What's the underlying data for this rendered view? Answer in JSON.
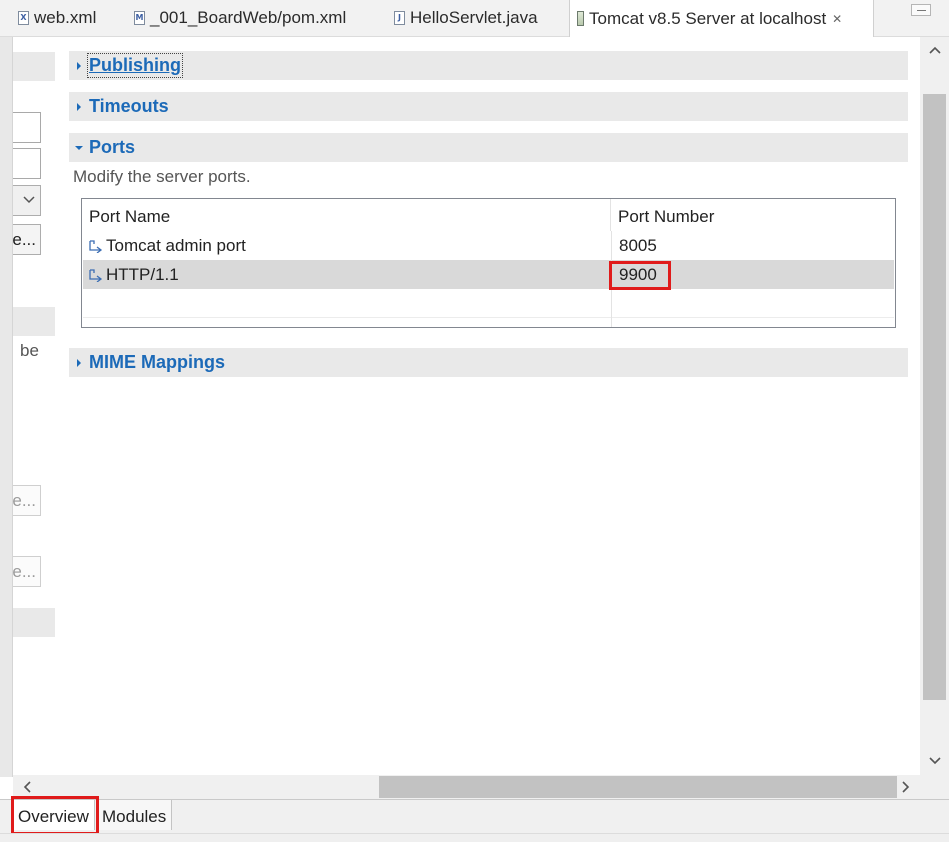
{
  "tabs": [
    {
      "label": "web.xml",
      "icon": "xml-file-icon"
    },
    {
      "label": "_001_BoardWeb/pom.xml",
      "icon": "maven-pom-icon"
    },
    {
      "label": "HelloServlet.java",
      "icon": "java-file-icon"
    },
    {
      "label": "Tomcat v8.5 Server at localhost",
      "icon": "server-icon",
      "active": true
    }
  ],
  "left_pane": {
    "text_fragment": "be",
    "button1": "e...",
    "button2": "e...",
    "button3": "e..."
  },
  "sections": {
    "publishing": "Publishing",
    "timeouts": "Timeouts",
    "ports": "Ports",
    "mime": "MIME Mappings"
  },
  "ports": {
    "description": "Modify the server ports.",
    "columns": [
      "Port Name",
      "Port Number"
    ],
    "rows": [
      {
        "name": "Tomcat admin port",
        "number": "8005"
      },
      {
        "name": "HTTP/1.1",
        "number": "9900"
      }
    ]
  },
  "page_tabs": [
    "Overview",
    "Modules"
  ],
  "colors": {
    "section_title": "#1c6ab8",
    "highlight": "#e01b1b",
    "selected_row": "#d9d9d9"
  }
}
